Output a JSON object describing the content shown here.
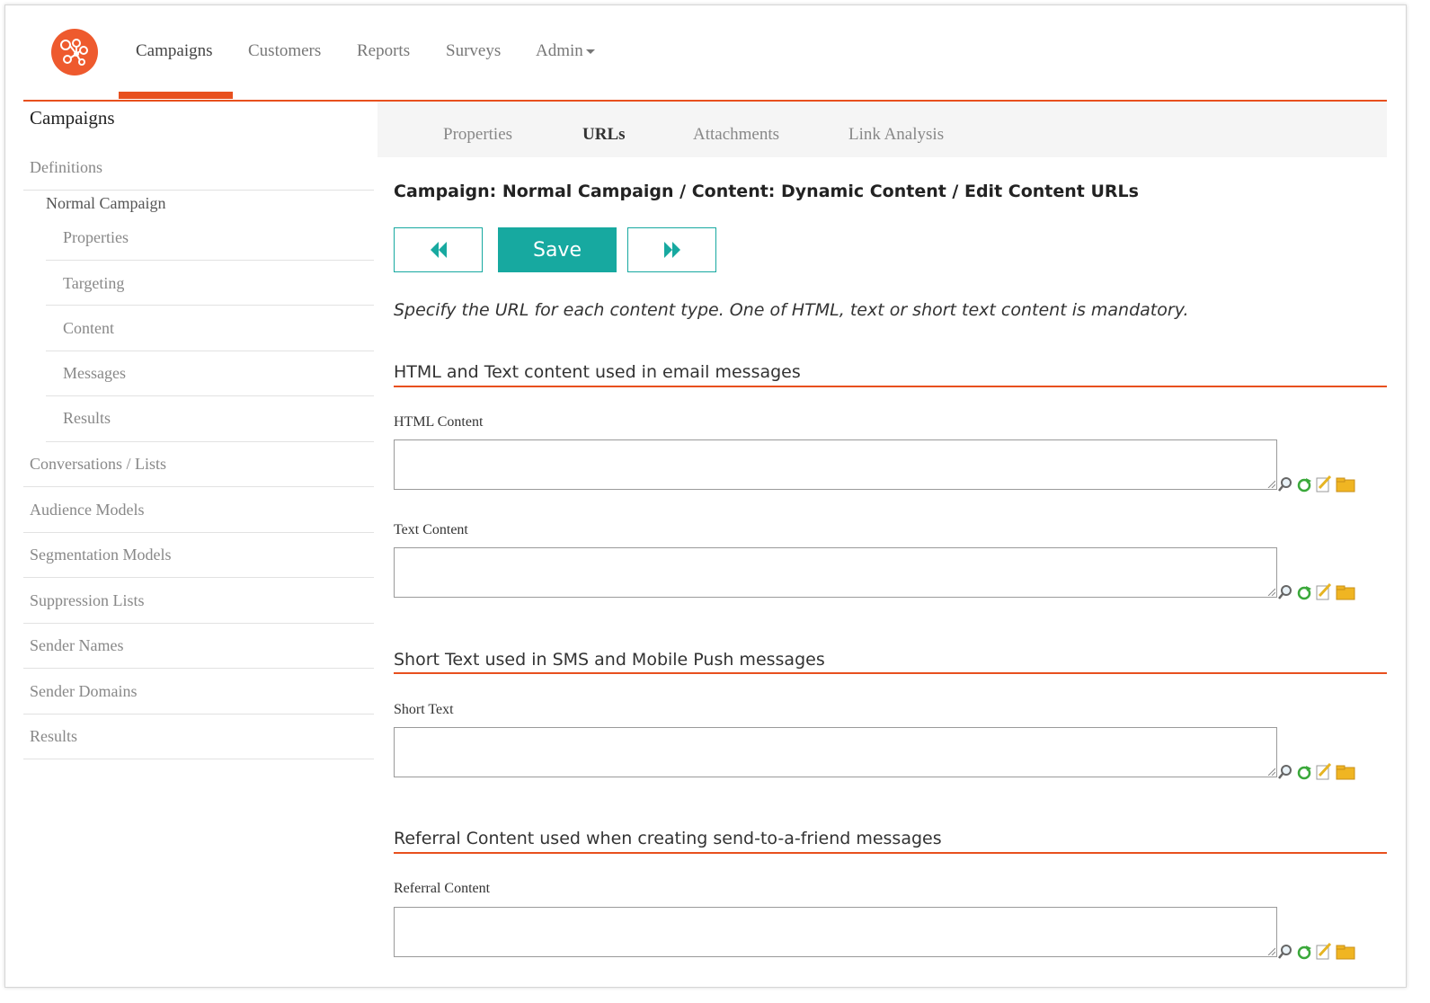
{
  "nav": {
    "items": [
      {
        "label": "Campaigns",
        "active": true
      },
      {
        "label": "Customers",
        "active": false
      },
      {
        "label": "Reports",
        "active": false
      },
      {
        "label": "Surveys",
        "active": false
      },
      {
        "label": "Admin",
        "active": false
      }
    ]
  },
  "sidebar": {
    "title": "Campaigns",
    "definitions": "Definitions",
    "campaign_name": "Normal Campaign",
    "sub_items": [
      "Properties",
      "Targeting",
      "Content",
      "Messages",
      "Results"
    ],
    "items": [
      "Conversations / Lists",
      "Audience Models",
      "Segmentation Models",
      "Suppression Lists",
      "Sender Names",
      "Sender Domains",
      "Results"
    ]
  },
  "tabs": [
    {
      "label": "Properties",
      "active": false
    },
    {
      "label": "URLs",
      "active": true
    },
    {
      "label": "Attachments",
      "active": false
    },
    {
      "label": "Link Analysis",
      "active": false
    }
  ],
  "main": {
    "heading": "Campaign: Normal Campaign / Content: Dynamic Content / Edit Content URLs",
    "save_label": "Save",
    "instruction": "Specify the URL for each content type. One of HTML, text or short text content is mandatory.",
    "sections": [
      {
        "title": "HTML and Text content used in email messages",
        "fields": [
          {
            "label": "HTML Content",
            "value": ""
          },
          {
            "label": "Text Content",
            "value": ""
          }
        ]
      },
      {
        "title": "Short Text used in SMS and Mobile Push messages",
        "fields": [
          {
            "label": "Short Text",
            "value": ""
          }
        ]
      },
      {
        "title": "Referral Content used when creating send-to-a-friend messages",
        "fields": [
          {
            "label": "Referral Content",
            "value": ""
          }
        ]
      }
    ]
  },
  "icons": {
    "logo": "network-logo-icon",
    "prev": "double-chevron-left-icon",
    "next": "double-chevron-right-icon",
    "field_tools": [
      "magnifier-icon",
      "refresh-icon",
      "edit-icon",
      "folder-icon"
    ]
  },
  "colors": {
    "accent": "#e8501e",
    "primary": "#17a9a0"
  }
}
